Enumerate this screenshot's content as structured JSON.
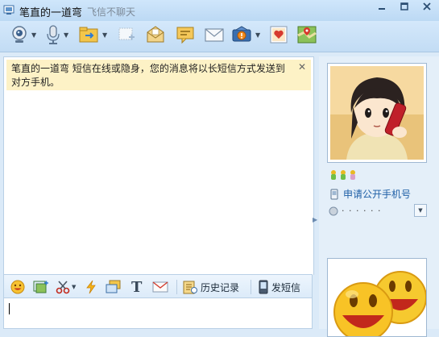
{
  "titlebar": {
    "contact_name": "笔直的一道弯",
    "status_text": "飞信不聊天"
  },
  "toolbar": {
    "icons": [
      "webcam-icon",
      "microphone-icon",
      "file-transfer-icon",
      "add-contact-icon",
      "mail-envelope-icon",
      "message-note-icon",
      "email-icon",
      "app-box-icon",
      "card-icon",
      "map-icon"
    ]
  },
  "notice": {
    "text": "笔直的一道弯 短信在线或隐身，您的消息将以长短信方式发送到对方手机。",
    "close": "✕"
  },
  "input_toolbar": {
    "history_label": "历史记录",
    "sms_label": "发短信",
    "font_glyph": "T"
  },
  "profile": {
    "phone_link": "申请公开手机号",
    "signature": "· ·  ·  ·  · ·"
  },
  "colors": {
    "notice_bg": "#fdf2c6",
    "link": "#1e5fa6",
    "pane_bg": "#e4eff9"
  }
}
